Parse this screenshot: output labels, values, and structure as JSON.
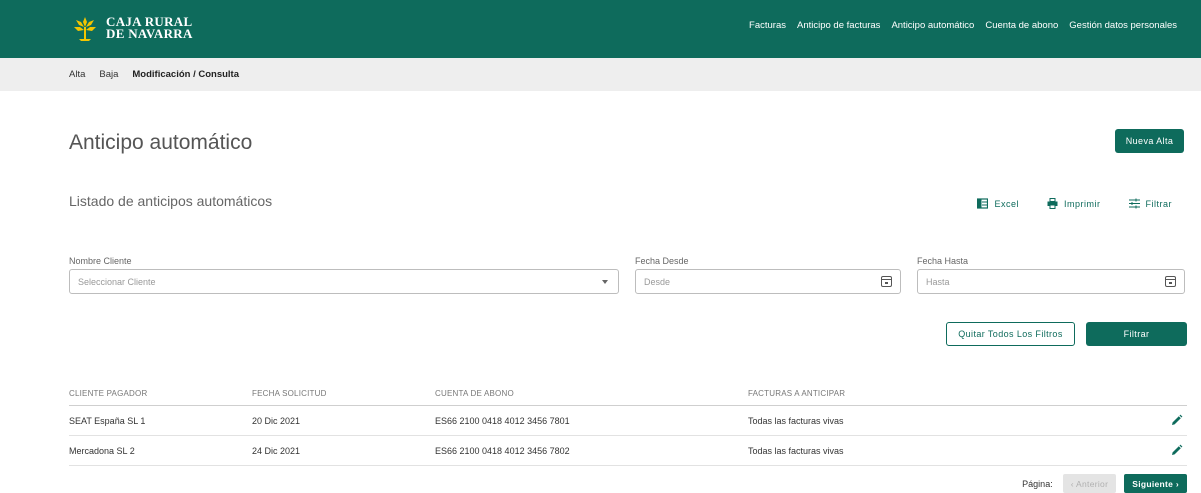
{
  "brand": {
    "line1": "CAJA RURAL",
    "line2": "DE NAVARRA"
  },
  "topnav": [
    "Facturas",
    "Anticipo de facturas",
    "Anticipo automático",
    "Cuenta de abono",
    "Gestión datos personales"
  ],
  "subnav": {
    "items": [
      "Alta",
      "Baja",
      "Modificación / Consulta"
    ],
    "active_index": 2
  },
  "page": {
    "title": "Anticipo automático",
    "new_button": "Nueva Alta"
  },
  "list": {
    "title": "Listado de anticipos automáticos"
  },
  "tools": {
    "excel": "Excel",
    "print": "Imprimir",
    "filter": "Filtrar"
  },
  "filters": {
    "client": {
      "label": "Nombre Cliente",
      "placeholder": "Seleccionar Cliente"
    },
    "from": {
      "label": "Fecha Desde",
      "placeholder": "Desde"
    },
    "to": {
      "label": "Fecha Hasta",
      "placeholder": "Hasta"
    },
    "clear_button": "Quitar Todos Los Filtros",
    "apply_button": "Filtrar"
  },
  "table": {
    "headers": [
      "CLIENTE PAGADOR",
      "FECHA SOLICITUD",
      "CUENTA DE ABONO",
      "FACTURAS A ANTICIPAR"
    ],
    "rows": [
      [
        "SEAT España SL 1",
        "20 Dic 2021",
        "ES66 2100 0418 4012 3456 7801",
        "Todas las facturas vivas"
      ],
      [
        "Mercadona SL 2",
        "24 Dic 2021",
        "ES66 2100 0418 4012 3456 7802",
        "Todas las facturas vivas"
      ]
    ]
  },
  "pagination": {
    "label": "Página:",
    "prev": "Anterior",
    "next": "Siguiente"
  },
  "colors": {
    "brand": "#0e6b5c",
    "logo_accent": "#f2c500"
  }
}
